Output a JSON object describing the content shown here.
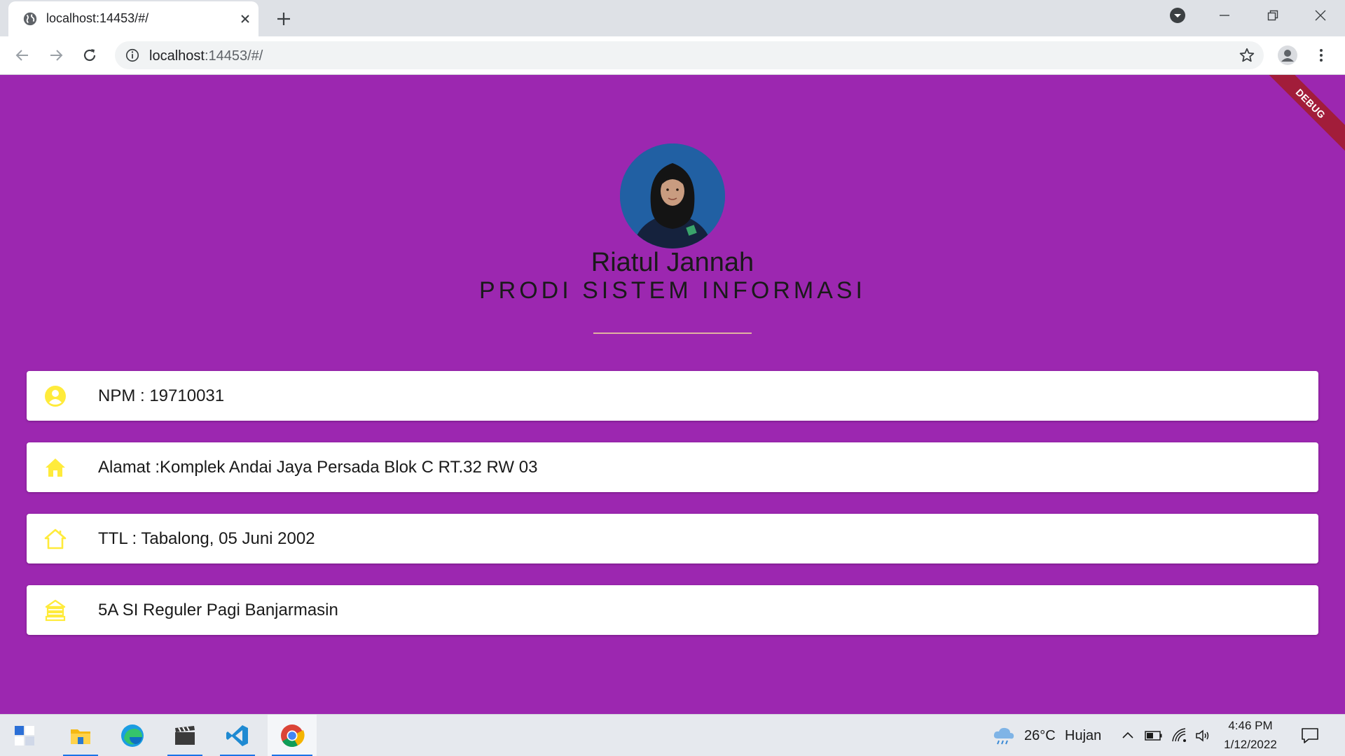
{
  "browser": {
    "tab": {
      "title": "localhost:14453/#/"
    },
    "address_bar": {
      "url_host": "localhost",
      "url_rest": ":14453/#/"
    }
  },
  "app": {
    "debug_banner": "DEBUG",
    "profile": {
      "name": "Riatul Jannah",
      "prodi": "PRODI SISTEM INFORMASI"
    },
    "cards": [
      {
        "icon": "account-circle-icon",
        "text": "NPM : 19710031"
      },
      {
        "icon": "home-icon",
        "text": "Alamat :Komplek Andai Jaya Persada Blok C RT.32 RW 03"
      },
      {
        "icon": "home-outline-icon",
        "text": "TTL : Tabalong, 05 Juni 2002"
      },
      {
        "icon": "school-building-icon",
        "text": "5A SI Reguler Pagi Banjarmasin"
      }
    ],
    "colors": {
      "background": "#9c27b0",
      "icon_accent": "#ffeb3b",
      "card": "#ffffff"
    }
  },
  "taskbar": {
    "apps": [
      "start-icon",
      "file-explorer-icon",
      "edge-icon",
      "video-editor-icon",
      "vscode-icon",
      "chrome-icon"
    ],
    "weather": {
      "temp": "26°C",
      "condition": "Hujan"
    },
    "clock": {
      "time": "4:46 PM",
      "date": "1/12/2022"
    }
  }
}
